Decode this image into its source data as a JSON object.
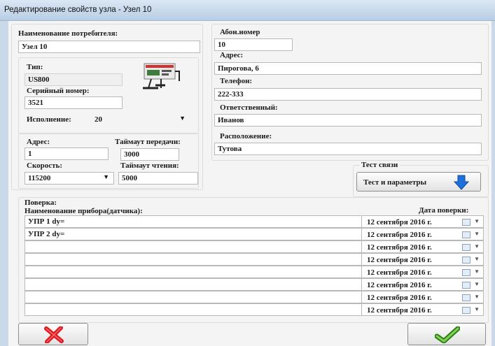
{
  "window": {
    "title": "Редактирование свойств узла - Узел 10"
  },
  "consumer": {
    "label": "Наименование потребителя:",
    "value": "Узел 10"
  },
  "device": {
    "type_label": "Тип:",
    "type_value": "US800",
    "serial_label": "Серийный номер:",
    "serial_value": "3521",
    "execution_label": "Исполнение:",
    "execution_value": "20"
  },
  "connection": {
    "address_label": "Адрес:",
    "address_value": "1",
    "tx_timeout_label": "Таймаут передачи:",
    "tx_timeout_value": "3000",
    "speed_label": "Скорость:",
    "speed_value": "115200",
    "rx_timeout_label": "Таймаут чтения:",
    "rx_timeout_value": "5000"
  },
  "subscriber": {
    "abon_label": "Абон.номер",
    "abon_value": "10",
    "address_label": "Адрес:",
    "address_value": "Пирогова, 6",
    "phone_label": "Телефон:",
    "phone_value": "222-333",
    "responsible_label": "Ответственный:",
    "responsible_value": "Иванов",
    "location_label": "Расположение:",
    "location_value": "Тутова"
  },
  "test": {
    "group_label": "Тест связи",
    "button_label": "Тест и параметры"
  },
  "calibration": {
    "group_label": "Поверка:",
    "name_header": "Наименование прибора(датчика):",
    "date_header": "Дата поверки:",
    "rows": [
      {
        "name": "УПР 1 dy=",
        "date": "12 сентября 2016 г."
      },
      {
        "name": "УПР 2 dy=",
        "date": "12 сентября 2016 г."
      },
      {
        "name": "",
        "date": "12 сентября 2016 г."
      },
      {
        "name": "",
        "date": "12 сентября 2016 г."
      },
      {
        "name": "",
        "date": "12 сентября 2016 г."
      },
      {
        "name": "",
        "date": "12 сентября 2016 г."
      },
      {
        "name": "",
        "date": "12 сентября 2016 г."
      },
      {
        "name": "",
        "date": "12 сентября 2016 г."
      }
    ]
  },
  "colors": {
    "cancel": "#e0161f",
    "ok": "#4caf2a",
    "arrow": "#1e6fd9"
  }
}
